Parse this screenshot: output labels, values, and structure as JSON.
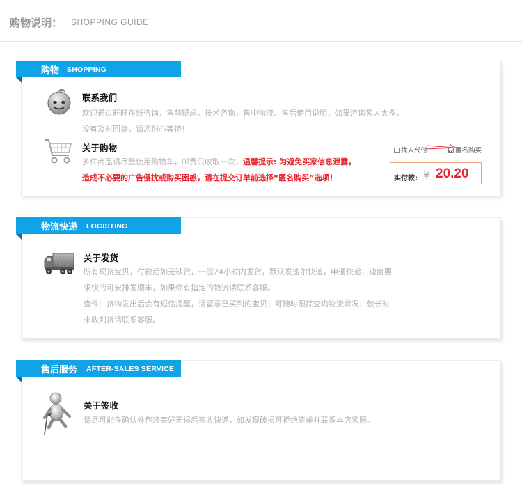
{
  "page_header": {
    "title_cn": "购物说明：",
    "title_en": "SHOPPING GUIDE"
  },
  "sections": [
    {
      "title_cn": "购物",
      "title_en": "SHOPPING",
      "items": [
        {
          "icon": "smiley-chat-icon",
          "title": "联系我们",
          "lines": [
            "欢迎通过旺旺在线咨询，售前疑虑，技术咨询，售中物流，售后使用说明，如果咨询客人太多，",
            "没有及时回复，请您耐心等待！"
          ]
        },
        {
          "icon": "shopping-cart-icon",
          "title": "关于购物",
          "line1_gray": "多件商品请尽量使用购物车，邮费只收取一次，",
          "line1_warn": "温馨提示: 为避免买家信息泄露，",
          "line2_warn": "造成不必要的广告侵扰或购买困惑，请在提交订单前选择“匿名购买”选项！"
        }
      ],
      "payment": {
        "option1": "找人代付",
        "option1_checked": false,
        "option2": "匿名购买",
        "option2_checked": true,
        "label": "实付款:",
        "currency": "¥",
        "amount": "20.20"
      }
    },
    {
      "title_cn": "物流快递",
      "title_en": "LOGISTING",
      "items": [
        {
          "icon": "truck-icon",
          "title": "关于发货",
          "lines": [
            "所有现货宝贝，付款后如无缺货，一般24小时内发货，默认发速尔快递，申通快递，速度要",
            "求快的可安排发顺丰，如果你有指定的物流请联系客服。",
            "查件：货物发出后会有短信提醒，请留意已买到的宝贝，可随时跟踪查询物流状况，较长时",
            "未收到货请联系客服。"
          ]
        }
      ]
    },
    {
      "title_cn": "售后服务",
      "title_en": "AFTER-SALES SERVICE",
      "items": [
        {
          "icon": "person-signing-icon",
          "title": "关于签收",
          "lines": [
            "请尽可能在确认外包装完好无损后签收快递，如发现破损可拒绝签单并联系本店客服。"
          ]
        }
      ]
    }
  ],
  "colors": {
    "ribbon": "#11a3e8",
    "warning": "#e8262d"
  }
}
